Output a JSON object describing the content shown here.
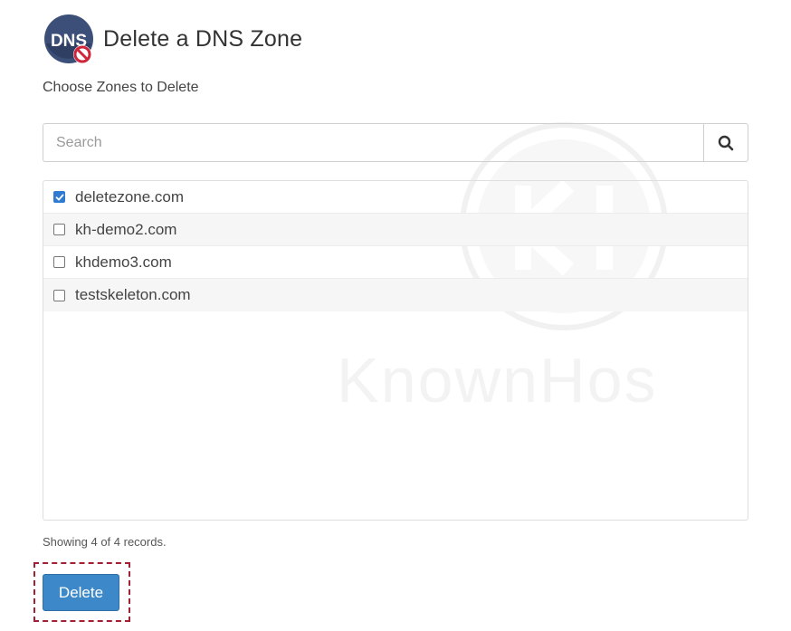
{
  "header": {
    "icon_text": "DNS",
    "title": "Delete a DNS Zone"
  },
  "subtitle": "Choose Zones to Delete",
  "search": {
    "placeholder": "Search",
    "value": ""
  },
  "zones": [
    {
      "label": "deletezone.com",
      "checked": true
    },
    {
      "label": "kh-demo2.com",
      "checked": false
    },
    {
      "label": "khdemo3.com",
      "checked": false
    },
    {
      "label": "testskeleton.com",
      "checked": false
    }
  ],
  "records_info": "Showing 4 of 4 records.",
  "delete_button": {
    "label": "Delete"
  },
  "watermark": {
    "logo_text": "KH",
    "text": "KnownHos"
  },
  "colors": {
    "primary_button": "#3d88c9",
    "checkbox_checked": "#2e7bd1",
    "highlight_outline": "#a32034",
    "icon_circle": "#3c4f78",
    "icon_badge": "#d0243a"
  }
}
